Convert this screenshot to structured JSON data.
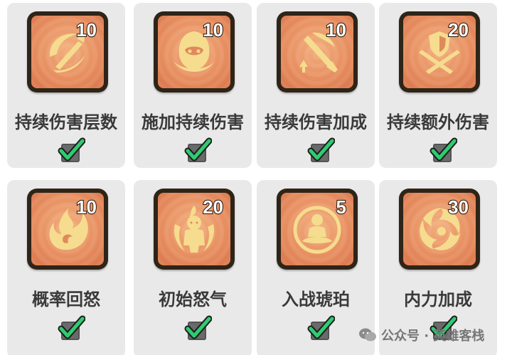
{
  "talents": [
    {
      "label": "持续伤害层数",
      "count": "10",
      "checked": true,
      "icon": "slash-swirl-icon"
    },
    {
      "label": "施加持续伤害",
      "count": "10",
      "checked": true,
      "icon": "hooded-assassin-icon"
    },
    {
      "label": "持续伤害加成",
      "count": "10",
      "checked": true,
      "icon": "blade-up-arrow-icon"
    },
    {
      "label": "持续额外伤害",
      "count": "20",
      "checked": true,
      "icon": "crossed-swords-shield-icon"
    },
    {
      "label": "概率回怒",
      "count": "10",
      "checked": true,
      "icon": "flame-swirl-icon"
    },
    {
      "label": "初始怒气",
      "count": "20",
      "checked": true,
      "icon": "fire-warrior-icon"
    },
    {
      "label": "入战琥珀",
      "count": "5",
      "checked": true,
      "icon": "meditating-figure-icon"
    },
    {
      "label": "内力加成",
      "count": "30",
      "checked": true,
      "icon": "vortex-icon"
    }
  ],
  "watermark": {
    "text": "公众号 · 英雄客栈",
    "icon": "wechat-icon"
  },
  "colors": {
    "tile_orange": "#e89062",
    "icon_gold": "#f6dc8e",
    "check_green": "#2ecc71"
  }
}
